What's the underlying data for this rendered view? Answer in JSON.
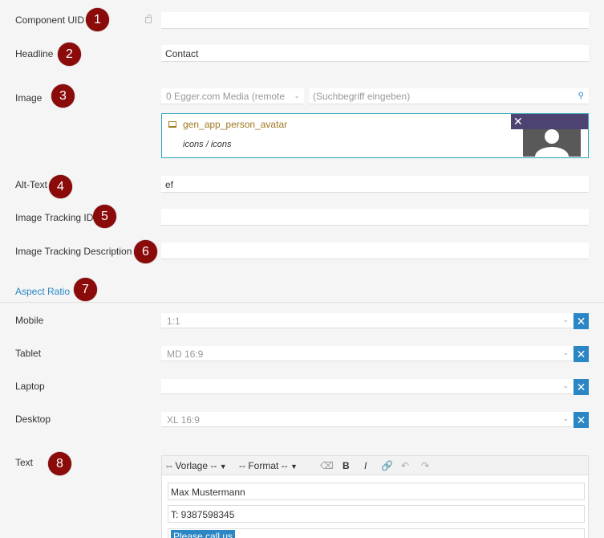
{
  "fields": {
    "component_uid": {
      "label": "Component UID",
      "value": ""
    },
    "headline": {
      "label": "Headline",
      "value": "Contact"
    },
    "image": {
      "label": "Image",
      "source_select": "0 Egger.com Media (remote",
      "search_placeholder": "(Suchbegriff eingeben)",
      "selected_name": "gen_app_person_avatar",
      "selected_path": "icons / icons",
      "remove_glyph": "✕"
    },
    "alt_text": {
      "label": "Alt-Text",
      "value": "ef"
    },
    "image_tracking_id": {
      "label": "Image Tracking ID",
      "value": ""
    },
    "image_tracking_description": {
      "label": "Image Tracking Description",
      "value": ""
    }
  },
  "aspect_ratio": {
    "title": "Aspect Ratio",
    "rows": [
      {
        "label": "Mobile",
        "value": "1:1"
      },
      {
        "label": "Tablet",
        "value": "MD 16:9"
      },
      {
        "label": "Laptop",
        "value": ""
      },
      {
        "label": "Desktop",
        "value": "XL 16:9"
      }
    ],
    "clear_glyph": "✕"
  },
  "text": {
    "label": "Text",
    "toolbar": {
      "template_select": "-- Vorlage --",
      "format_select": "-- Format --",
      "bold": "B",
      "italic": "I"
    },
    "lines": [
      "Max Mustermann",
      "T: 9387598345",
      "Please call us"
    ]
  },
  "badges": [
    "1",
    "2",
    "3",
    "4",
    "5",
    "6",
    "7",
    "8"
  ],
  "colors": {
    "badge": "#8b0a0a",
    "accent": "#2b86c5",
    "media_header": "#4d4272",
    "media_border": "#2aa5b5",
    "link": "#2b86c5"
  }
}
